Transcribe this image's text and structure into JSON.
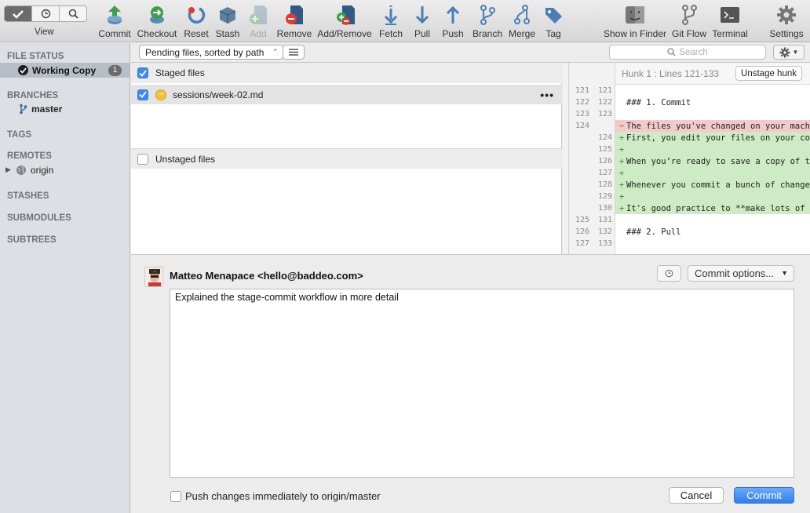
{
  "toolbar": {
    "view_label": "View",
    "buttons": [
      {
        "label": "Commit",
        "icon": "commit-icon",
        "enabled": true
      },
      {
        "label": "Checkout",
        "icon": "checkout-icon",
        "enabled": true
      },
      {
        "label": "Reset",
        "icon": "reset-icon",
        "enabled": true
      },
      {
        "label": "Stash",
        "icon": "stash-icon",
        "enabled": true
      },
      {
        "label": "Add",
        "icon": "add-icon",
        "enabled": false
      },
      {
        "label": "Remove",
        "icon": "remove-icon",
        "enabled": true
      },
      {
        "label": "Add/Remove",
        "icon": "add-remove-icon",
        "enabled": true
      },
      {
        "label": "Fetch",
        "icon": "fetch-icon",
        "enabled": true
      },
      {
        "label": "Pull",
        "icon": "pull-icon",
        "enabled": true
      },
      {
        "label": "Push",
        "icon": "push-icon",
        "enabled": true
      },
      {
        "label": "Branch",
        "icon": "branch-icon",
        "enabled": true
      },
      {
        "label": "Merge",
        "icon": "merge-icon",
        "enabled": true
      },
      {
        "label": "Tag",
        "icon": "tag-icon",
        "enabled": true
      },
      {
        "label": "Show in Finder",
        "icon": "finder-icon",
        "enabled": true
      },
      {
        "label": "Git Flow",
        "icon": "git-flow-icon",
        "enabled": true
      },
      {
        "label": "Terminal",
        "icon": "terminal-icon",
        "enabled": true
      },
      {
        "label": "Settings",
        "icon": "settings-icon",
        "enabled": true
      }
    ]
  },
  "sidebar": {
    "file_status": "FILE STATUS",
    "working_copy": "Working Copy",
    "working_copy_count": "1",
    "branches": "BRANCHES",
    "branch_master": "master",
    "tags": "TAGS",
    "remotes": "REMOTES",
    "remote_origin": "origin",
    "stashes": "STASHES",
    "submodules": "SUBMODULES",
    "subtrees": "SUBTREES"
  },
  "filebar": {
    "sort_dropdown": "Pending files, sorted by path",
    "search_placeholder": "Search"
  },
  "files": {
    "staged_header": "Staged files",
    "staged_file": "sessions/week-02.md",
    "unstaged_header": "Unstaged files"
  },
  "diff": {
    "hunk_title": "Hunk 1 : Lines 121-133",
    "unstage_button": "Unstage hunk",
    "lines": [
      {
        "old": "121",
        "new": "121",
        "type": "ctx",
        "marker": "",
        "text": ""
      },
      {
        "old": "122",
        "new": "122",
        "type": "ctx",
        "marker": "",
        "text": "### 1. Commit"
      },
      {
        "old": "123",
        "new": "123",
        "type": "ctx",
        "marker": "",
        "text": ""
      },
      {
        "old": "124",
        "new": "",
        "type": "del",
        "marker": "−",
        "text": "The files you've changed on your mach"
      },
      {
        "old": "",
        "new": "124",
        "type": "add",
        "marker": "+",
        "text": "First, you edit your files on your co"
      },
      {
        "old": "",
        "new": "125",
        "type": "add",
        "marker": "+",
        "text": ""
      },
      {
        "old": "",
        "new": "126",
        "type": "add",
        "marker": "+",
        "text": "When you’re ready to save a copy of t"
      },
      {
        "old": "",
        "new": "127",
        "type": "add",
        "marker": "+",
        "text": ""
      },
      {
        "old": "",
        "new": "128",
        "type": "add",
        "marker": "+",
        "text": "Whenever you commit a bunch of change"
      },
      {
        "old": "",
        "new": "129",
        "type": "add",
        "marker": "+",
        "text": ""
      },
      {
        "old": "",
        "new": "130",
        "type": "add",
        "marker": "+",
        "text": "It's good practice to **make lots of"
      },
      {
        "old": "125",
        "new": "131",
        "type": "ctx",
        "marker": "",
        "text": ""
      },
      {
        "old": "126",
        "new": "132",
        "type": "ctx",
        "marker": "",
        "text": "### 2. Pull"
      },
      {
        "old": "127",
        "new": "133",
        "type": "ctx",
        "marker": "",
        "text": ""
      }
    ]
  },
  "commit": {
    "author": "Matteo Menapace <hello@baddeo.com>",
    "options_button": "Commit options...",
    "message": "Explained the stage-commit workflow in more detail",
    "push_label": "Push changes immediately to origin/master",
    "cancel_button": "Cancel",
    "commit_button": "Commit"
  }
}
